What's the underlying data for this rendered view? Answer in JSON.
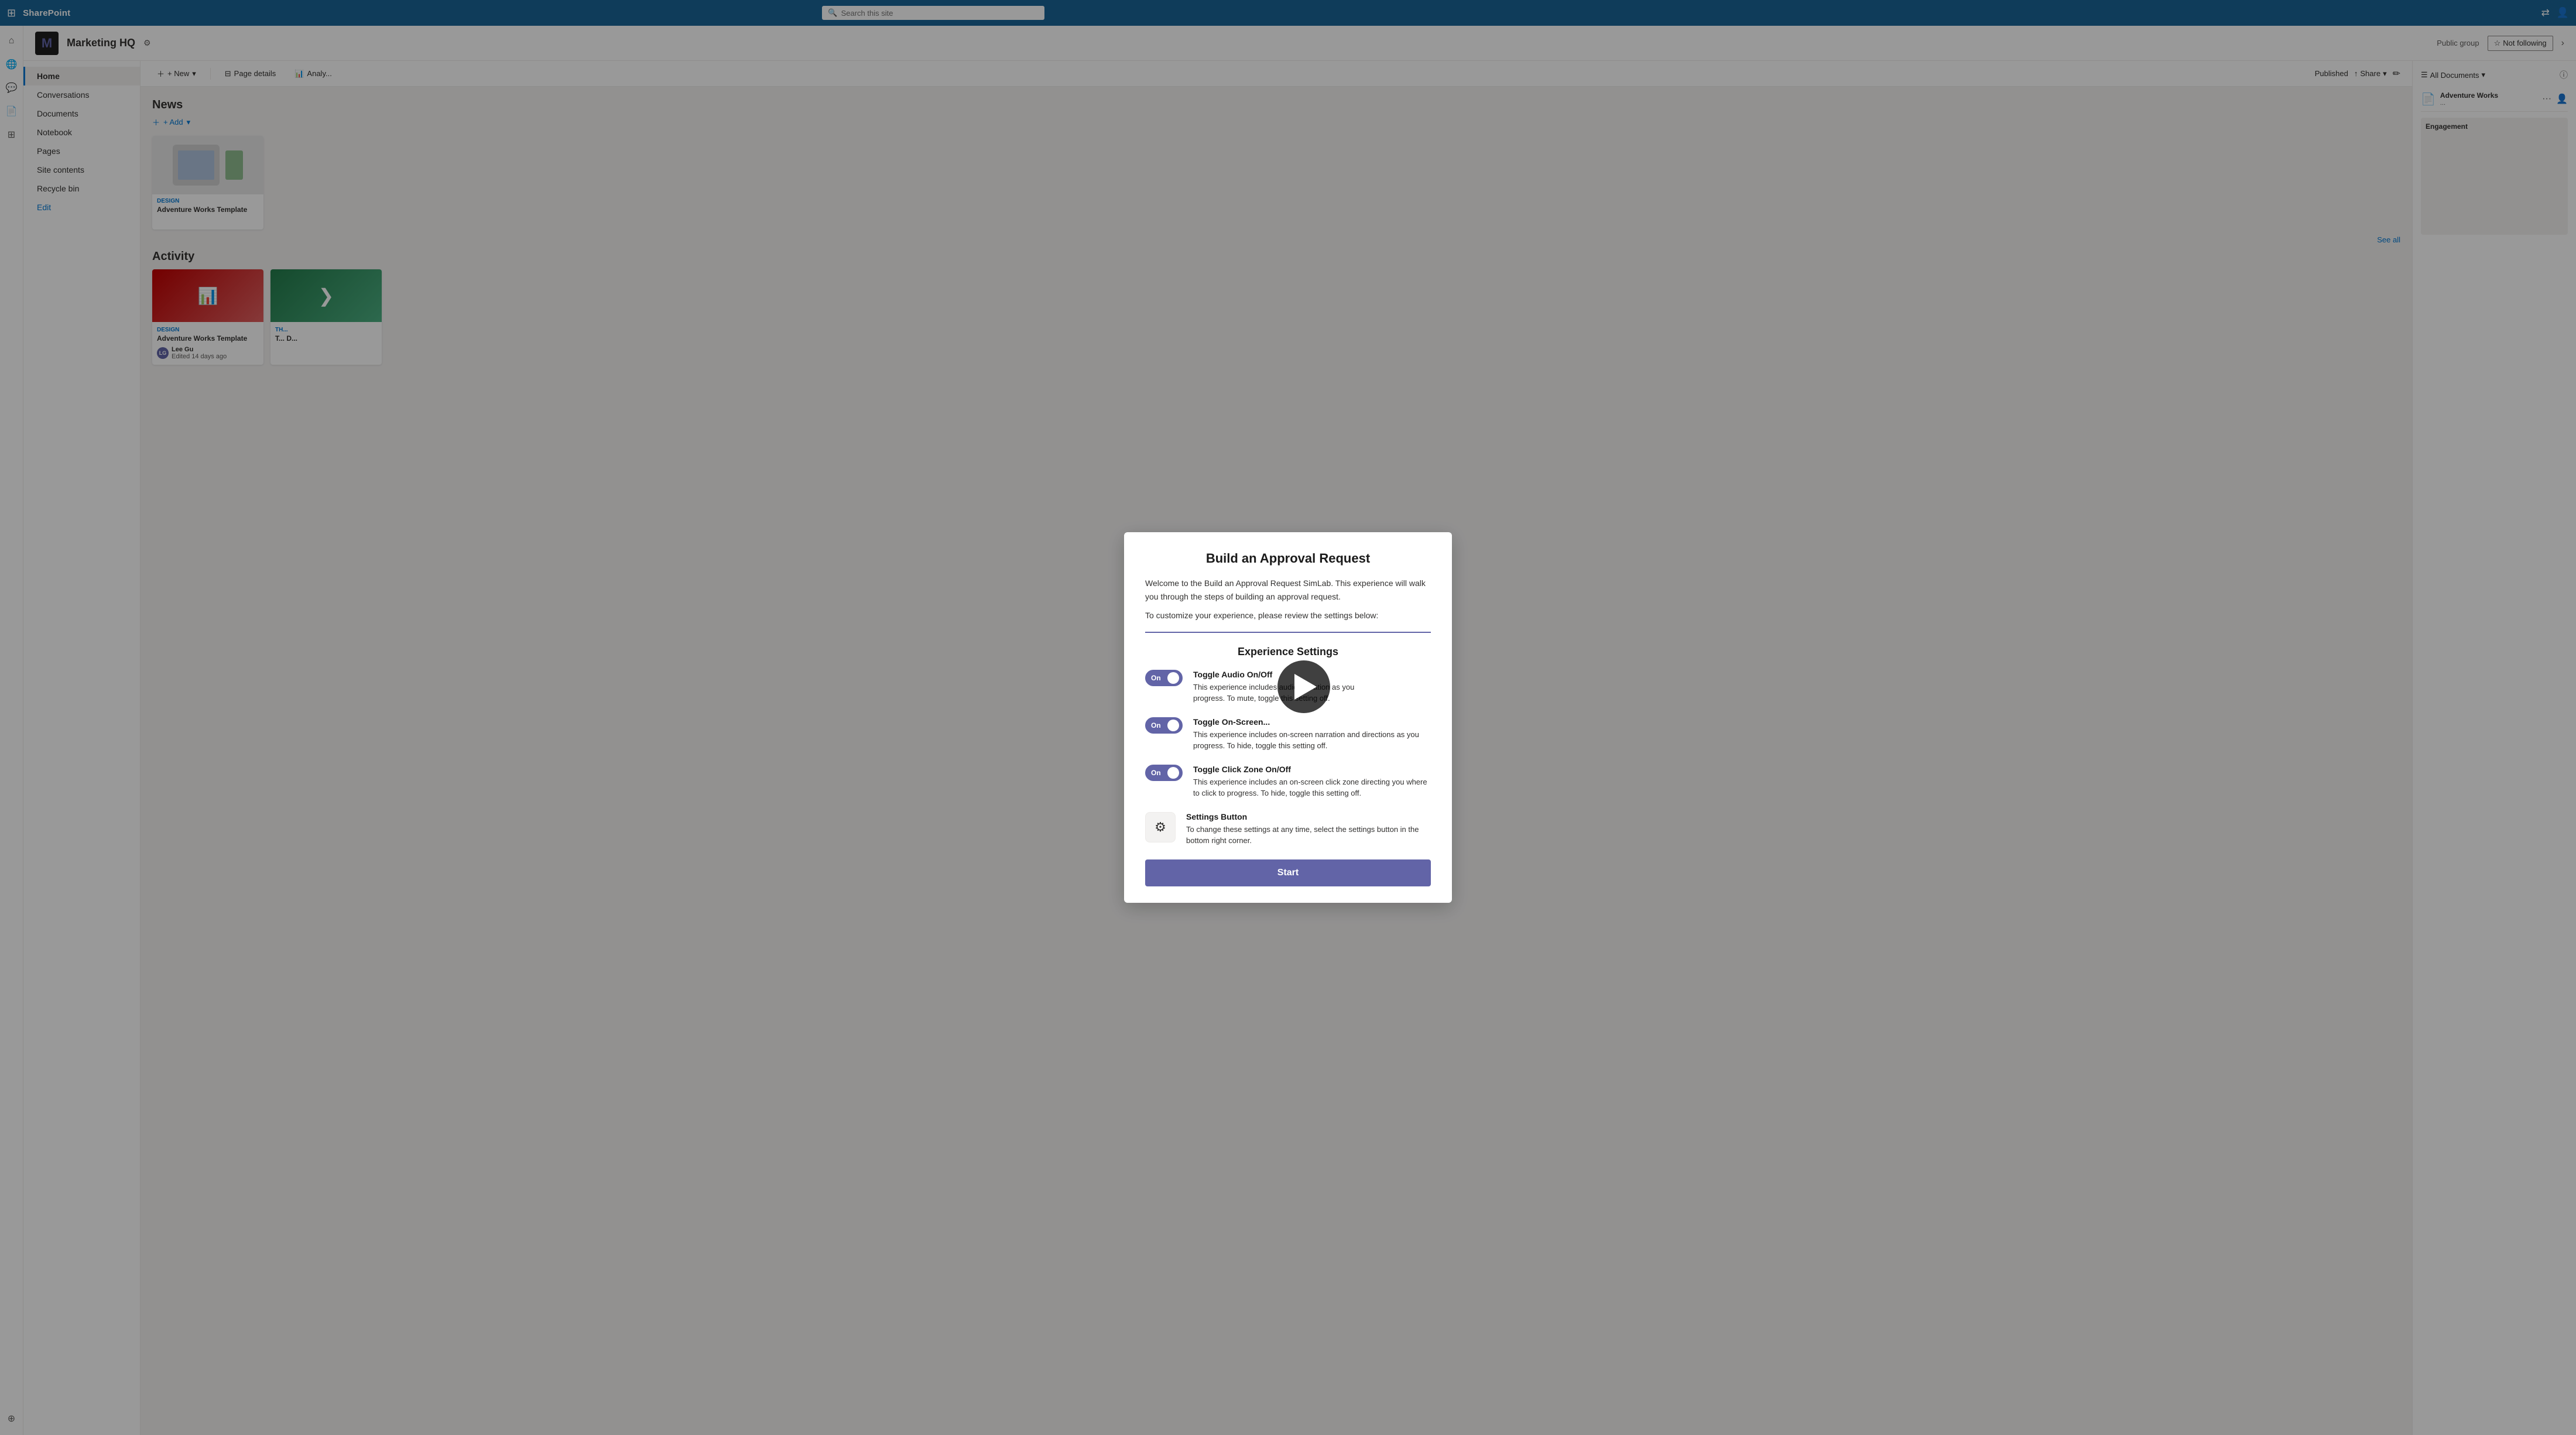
{
  "topBar": {
    "brand": "SharePoint",
    "searchPlaceholder": "Search this site",
    "waffleIcon": "⊞"
  },
  "siteHeader": {
    "logoEmoji": "🏢",
    "title": "Marketing HQ",
    "settingsIcon": "⚙",
    "publicGroup": "Public group",
    "notFollowing": "Not following"
  },
  "nav": {
    "items": [
      {
        "label": "Home",
        "active": true
      },
      {
        "label": "Conversations"
      },
      {
        "label": "Documents"
      },
      {
        "label": "Notebook"
      },
      {
        "label": "Pages"
      },
      {
        "label": "Site contents"
      },
      {
        "label": "Recycle bin"
      },
      {
        "label": "Edit",
        "edit": true
      }
    ]
  },
  "pageToolbar": {
    "newLabel": "+ New",
    "pageDetailsLabel": "Page details",
    "analyticsLabel": "Analy...",
    "publishedLabel": "Published",
    "shareLabel": "Share",
    "newDropdown": "▾",
    "shareDropdown": "▾"
  },
  "newsSection": {
    "title": "News",
    "addLabel": "+ Add",
    "seeAll": "See all",
    "card": {
      "tag": "Design",
      "title": "Adventure Works Template"
    }
  },
  "activitySection": {
    "title": "Activity",
    "cards": [
      {
        "tag": "Design",
        "title": "Adventure Works Template",
        "author": "Lee Gu",
        "edited": "Edited 14 days ago",
        "avatarInitials": "LG"
      },
      {
        "tag": "Th...",
        "title": "T... D...",
        "author": "",
        "edited": "",
        "avatarInitials": ""
      }
    ]
  },
  "docsPanel": {
    "allDocumentsLabel": "All Documents",
    "dropdownIcon": "▾",
    "infoIcon": "ⓘ"
  },
  "modal": {
    "title": "Build an Approval Request",
    "intro1": "Welcome to the Build an Approval Request SimLab. This experience will walk you through the steps of building an approval request.",
    "intro2": "To customize your experience, please review the settings below:",
    "sectionTitle": "Experience Settings",
    "toggles": [
      {
        "id": "audio",
        "on": true,
        "label": "On",
        "title": "Toggle Audio On/Off",
        "desc": "This experience includes audio narration as you progress. To mute, toggle this setting off."
      },
      {
        "id": "onscreen",
        "on": true,
        "label": "On",
        "title": "Toggle On-Screen...",
        "desc": "This experience includes on-screen narration and directions as you progress. To hide, toggle this setting off."
      },
      {
        "id": "clickzone",
        "on": true,
        "label": "On",
        "title": "Toggle Click Zone On/Off",
        "desc": "This experience includes an on-screen click zone directing you where to click to progress. To hide, toggle this setting off."
      }
    ],
    "settingsButton": {
      "icon": "⚙",
      "title": "Settings Button",
      "desc": "To change these settings at any time, select the settings button in the bottom right corner."
    },
    "startLabel": "Start"
  }
}
